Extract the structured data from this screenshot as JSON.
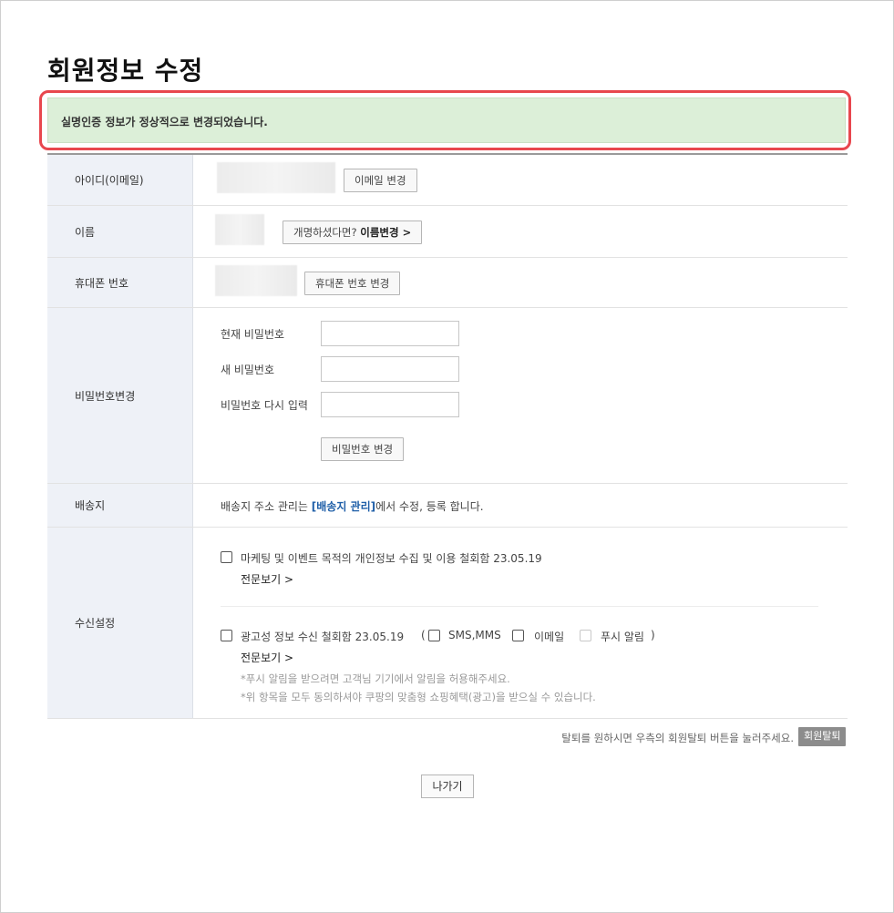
{
  "page": {
    "title": "회원정보 수정",
    "notice": "실명인증 정보가 정상적으로 변경되었습니다."
  },
  "rows": {
    "id": {
      "label": "아이디(이메일)",
      "button": "이메일 변경"
    },
    "name": {
      "label": "이름",
      "button_prefix": "개명하셨다면? ",
      "button_strong": "이름변경 >"
    },
    "phone": {
      "label": "휴대폰 번호",
      "button": "휴대폰 번호 변경"
    },
    "password": {
      "label": "비밀번호변경",
      "current_label": "현재 비밀번호",
      "new_label": "새 비밀번호",
      "confirm_label": "비밀번호 다시 입력",
      "button": "비밀번호 변경"
    },
    "shipping": {
      "label": "배송지",
      "text_before": "배송지 주소 관리는 ",
      "link": "[배송지 관리]",
      "text_after": "에서 수정, 등록 합니다."
    },
    "receive": {
      "label": "수신설정",
      "marketing_text": "마케팅 및 이벤트 목적의 개인정보 수집 및 이용 철회함 23.05.19",
      "marketing_more": "전문보기 >",
      "ad_text": "광고성 정보 수신 철회함 23.05.19",
      "open_paren": "(",
      "sms": "SMS,MMS",
      "email": "이메일",
      "push": "푸시 알림",
      "close_paren": ")",
      "ad_more": "전문보기 >",
      "note1": "*푸시 알림을 받으려면 고객님 기기에서 알림을 허용해주세요.",
      "note2": "*위 항목을 모두 동의하셔야 쿠팡의 맞춤형 쇼핑혜택(광고)을 받으실 수 있습니다."
    }
  },
  "footer": {
    "withdraw_text": "탈퇴를 원하시면 우측의 회원탈퇴 버튼을 눌러주세요.",
    "withdraw_button": "회원탈퇴",
    "exit_button": "나가기"
  },
  "colors": {
    "notice_bg": "#dcefd8",
    "highlight_border": "#e8474e",
    "link": "#1f5fa8",
    "header_cell_bg": "#eef1f7"
  }
}
